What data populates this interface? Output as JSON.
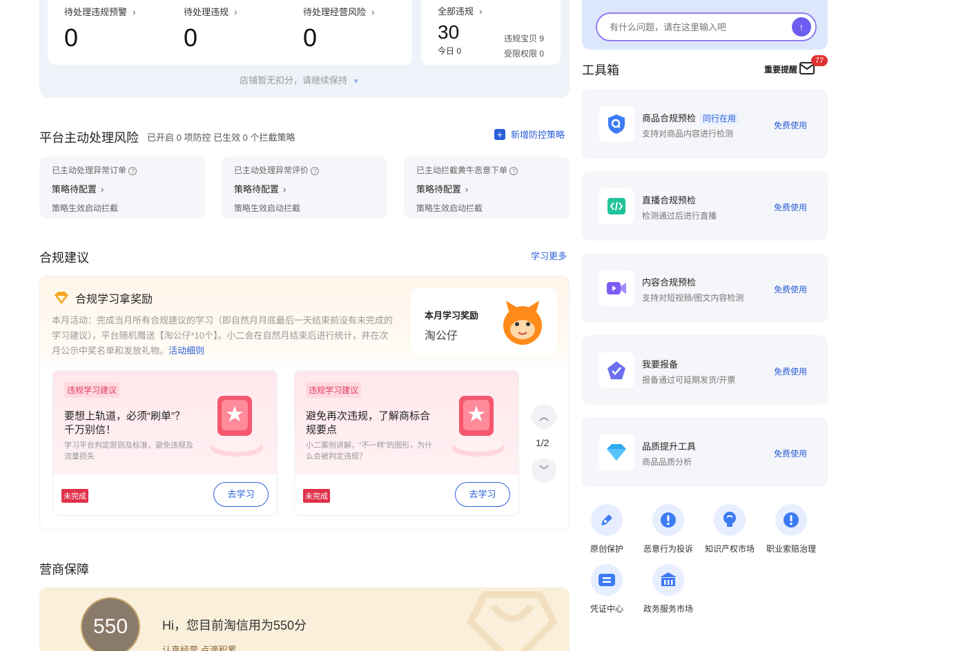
{
  "top_stats": {
    "items": [
      {
        "label": "待处理违规预警",
        "value": "0"
      },
      {
        "label": "待处理违规",
        "value": "0"
      },
      {
        "label": "待处理经营风险",
        "value": "0"
      }
    ],
    "all": {
      "label": "全部违规",
      "value": "30",
      "today_label": "今日",
      "today_value": "0",
      "bao_label": "违规宝贝",
      "bao_value": "9",
      "limit_label": "受限权限",
      "limit_value": "0"
    },
    "note": "店铺暂无扣分，请继续保持"
  },
  "platform": {
    "title": "平台主动处理风险",
    "subtitle": "已开启 0 项防控 已生效 0 个拦截策略",
    "add_label": "新增防控策略",
    "cards": [
      {
        "label": "已主动处理异常订单",
        "status": "策略待配置",
        "desc": "策略生效启动拦截"
      },
      {
        "label": "已主动处理异常评价",
        "status": "策略待配置",
        "desc": "策略生效启动拦截"
      },
      {
        "label": "已主动拦截黄牛恶意下单",
        "status": "策略待配置",
        "desc": "策略生效启动拦截"
      }
    ]
  },
  "compliance": {
    "title": "合规建议",
    "more": "学习更多",
    "reward_title": "合规学习拿奖励",
    "reward_desc": "本月活动：完成当月所有合规建议的学习（即自然月月底最后一天结束前没有未完成的学习建议），平台随机赠送【淘公仔*10个】。小二会在自然月结束后进行统计，并在次月公示中奖名单和发放礼物。",
    "reward_link": "活动细则",
    "month_reward_label": "本月学习奖励",
    "month_reward_value": "淘公仔",
    "cards": [
      {
        "tag": "违规学习建议",
        "title": "要想上轨道，必须“刷单”？千万别信！",
        "desc": "学习平台判定原则及标准，避免违规及流量损失",
        "badge": "未完成",
        "button": "去学习"
      },
      {
        "tag": "违规学习建议",
        "title": "避免再次违规，了解商标合规要点",
        "desc": "小二案例讲解，“不一样”的图形，为什么会被判定违规？",
        "badge": "未完成",
        "button": "去学习"
      }
    ],
    "pager": "1/2"
  },
  "guarantee": {
    "title": "营商保障",
    "score": "550",
    "greeting": "Hi，您目前淘信用为550分",
    "sub": "认真经营 点滴积累"
  },
  "right": {
    "search_placeholder": "有什么问题，请在这里输入吧",
    "toolbox_title": "工具箱",
    "reminder_label": "重要提醒",
    "reminder_count": "77",
    "tools": [
      {
        "icon": "shield-search-icon",
        "name": "商品合规预检",
        "tag": "同行在用",
        "desc": "支持对商品内容进行检测",
        "action": "免费使用"
      },
      {
        "icon": "code-icon",
        "name": "直播合规预检",
        "tag": "",
        "desc": "检测通过后进行直播",
        "action": "免费使用"
      },
      {
        "icon": "video-camera-icon",
        "name": "内容合规预检",
        "tag": "",
        "desc": "支持对短视频/图文内容检测",
        "action": "免费使用"
      },
      {
        "icon": "check-badge-icon",
        "name": "我要报备",
        "tag": "",
        "desc": "报备通过可延期发货/开票",
        "action": "免费使用"
      },
      {
        "icon": "diamond-icon",
        "name": "品质提升工具",
        "tag": "",
        "desc": "商品品质分析",
        "action": "免费使用"
      }
    ],
    "mini_tools": [
      {
        "icon": "pen-icon",
        "label": "原创保护"
      },
      {
        "icon": "warning-icon",
        "label": "恶意行为投诉"
      },
      {
        "icon": "bulb-icon",
        "label": "知识产权市场"
      },
      {
        "icon": "warning-icon",
        "label": "职业索赔治理"
      },
      {
        "icon": "ticket-icon",
        "label": "凭证中心"
      },
      {
        "icon": "bank-icon",
        "label": "政务服务市场"
      }
    ]
  }
}
